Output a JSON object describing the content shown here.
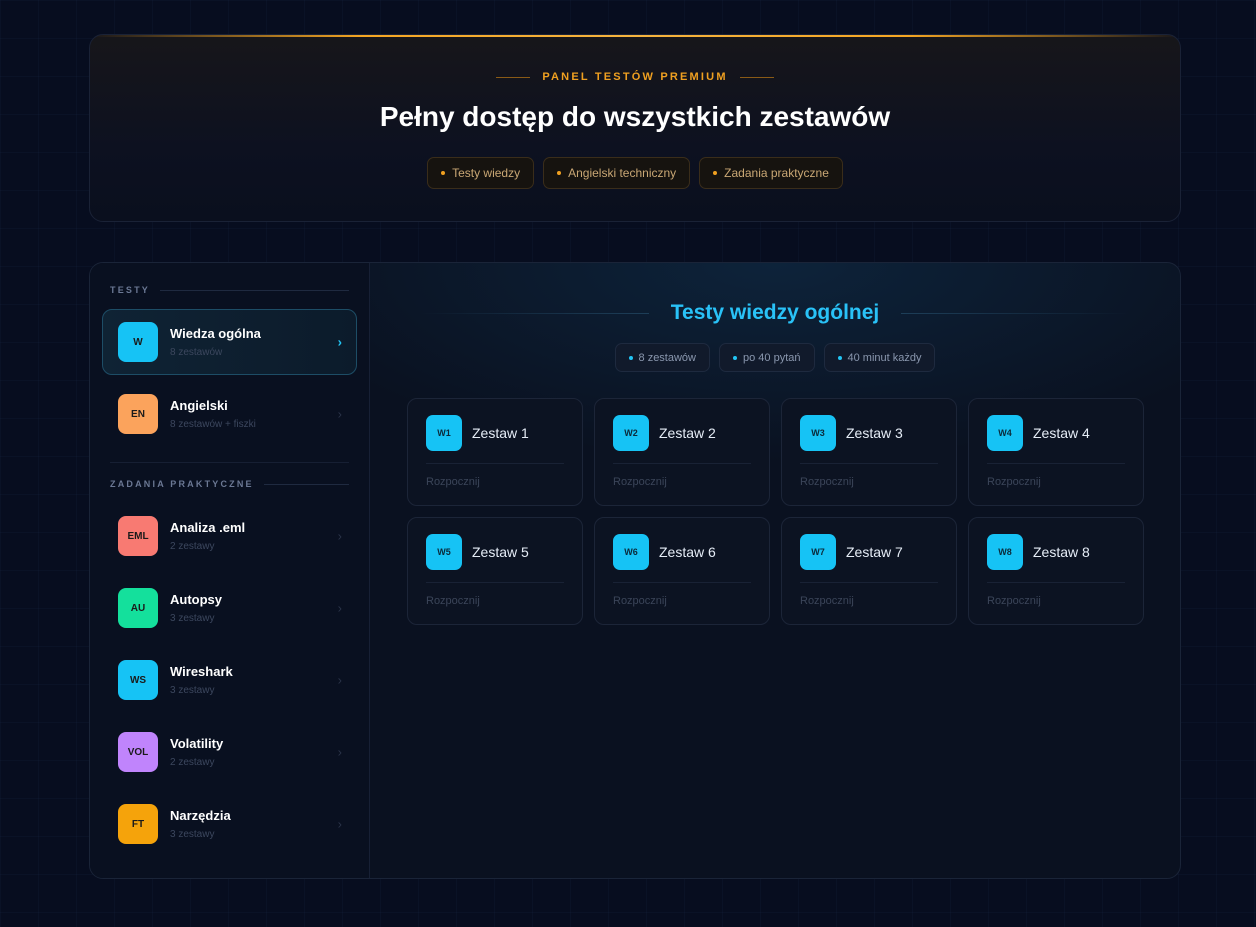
{
  "hero": {
    "eyebrow": "PANEL TESTÓW PREMIUM",
    "title": "Pełny dostęp do wszystkich zestawów",
    "pills": [
      "Testy wiedzy",
      "Angielski techniczny",
      "Zadania praktyczne"
    ]
  },
  "sidebar": {
    "section_tests": "TESTY",
    "section_practical": "ZADANIA PRAKTYCZNE",
    "tests": [
      {
        "badge": "W",
        "title": "Wiedza ogólna",
        "sub": "8 zestawów",
        "color": "#16c3f5",
        "active": true
      },
      {
        "badge": "EN",
        "title": "Angielski",
        "sub": "8 zestawów + fiszki",
        "color": "#fba35c",
        "active": false
      }
    ],
    "practical": [
      {
        "badge": "EML",
        "title": "Analiza .eml",
        "sub": "2 zestawy",
        "color": "#f87a72"
      },
      {
        "badge": "AU",
        "title": "Autopsy",
        "sub": "3 zestawy",
        "color": "#14e09c"
      },
      {
        "badge": "WS",
        "title": "Wireshark",
        "sub": "3 zestawy",
        "color": "#16c3f5"
      },
      {
        "badge": "VOL",
        "title": "Volatility",
        "sub": "2 zestawy",
        "color": "#c084fc"
      },
      {
        "badge": "FT",
        "title": "Narzędzia",
        "sub": "3 zestawy",
        "color": "#f5a30b"
      }
    ],
    "chevron": "›"
  },
  "content": {
    "title": "Testy wiedzy ogólnej",
    "stats": [
      "8 zestawów",
      "po 40 pytań",
      "40 minut każdy"
    ],
    "cards": [
      {
        "badge": "W1",
        "title": "Zestaw 1",
        "action": "Rozpocznij"
      },
      {
        "badge": "W2",
        "title": "Zestaw 2",
        "action": "Rozpocznij"
      },
      {
        "badge": "W3",
        "title": "Zestaw 3",
        "action": "Rozpocznij"
      },
      {
        "badge": "W4",
        "title": "Zestaw 4",
        "action": "Rozpocznij"
      },
      {
        "badge": "W5",
        "title": "Zestaw 5",
        "action": "Rozpocznij"
      },
      {
        "badge": "W6",
        "title": "Zestaw 6",
        "action": "Rozpocznij"
      },
      {
        "badge": "W7",
        "title": "Zestaw 7",
        "action": "Rozpocznij"
      },
      {
        "badge": "W8",
        "title": "Zestaw 8",
        "action": "Rozpocznij"
      }
    ]
  }
}
